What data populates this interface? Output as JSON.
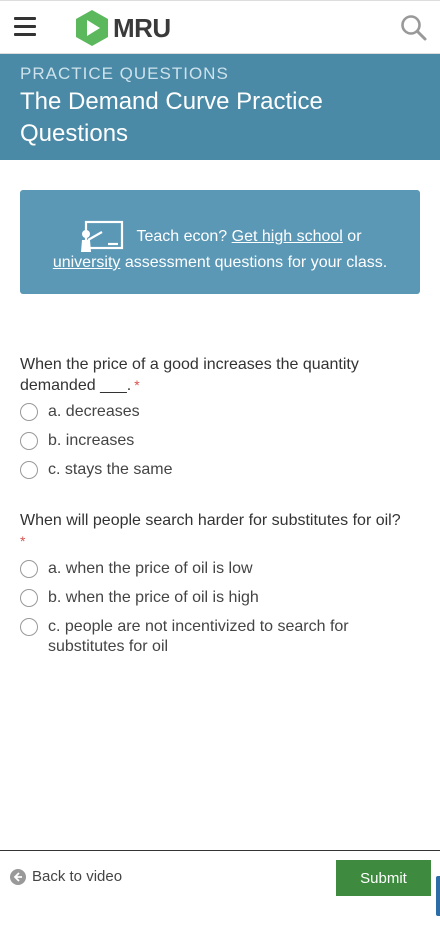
{
  "nav": {
    "logo_text": "MRU",
    "icons": {
      "menu": "hamburger-icon",
      "search": "search-icon",
      "logo": "play-hexagon-icon"
    },
    "colors": {
      "logo_green": "#5cb85c"
    }
  },
  "header": {
    "eyebrow": "PRACTICE QUESTIONS",
    "title": "The Demand Curve Practice Questions",
    "background": "#4a8aa6"
  },
  "promo": {
    "icon": "teacher-board-icon",
    "text_before": "Teach econ? ",
    "link_high_school": "Get high school",
    "text_or": " or",
    "link_university": "university",
    "text_after": " assessment questions for your class."
  },
  "questions": [
    {
      "text": "When the price of a good increases the quantity demanded ___.",
      "required_marker": "*",
      "options": [
        "a. decreases",
        "b. increases",
        "c. stays the same"
      ]
    },
    {
      "text": "When will people search harder for substitutes for oil?",
      "required_marker": "*",
      "options": [
        "a. when the price of oil is low",
        "b. when the price of oil is high",
        "c. people are not incentivized to search for substitutes for oil"
      ]
    }
  ],
  "footer": {
    "back_label": "Back to video",
    "back_icon": "arrow-left-circle-icon",
    "submit_label": "Submit",
    "submit_color": "#3e8a3e"
  }
}
